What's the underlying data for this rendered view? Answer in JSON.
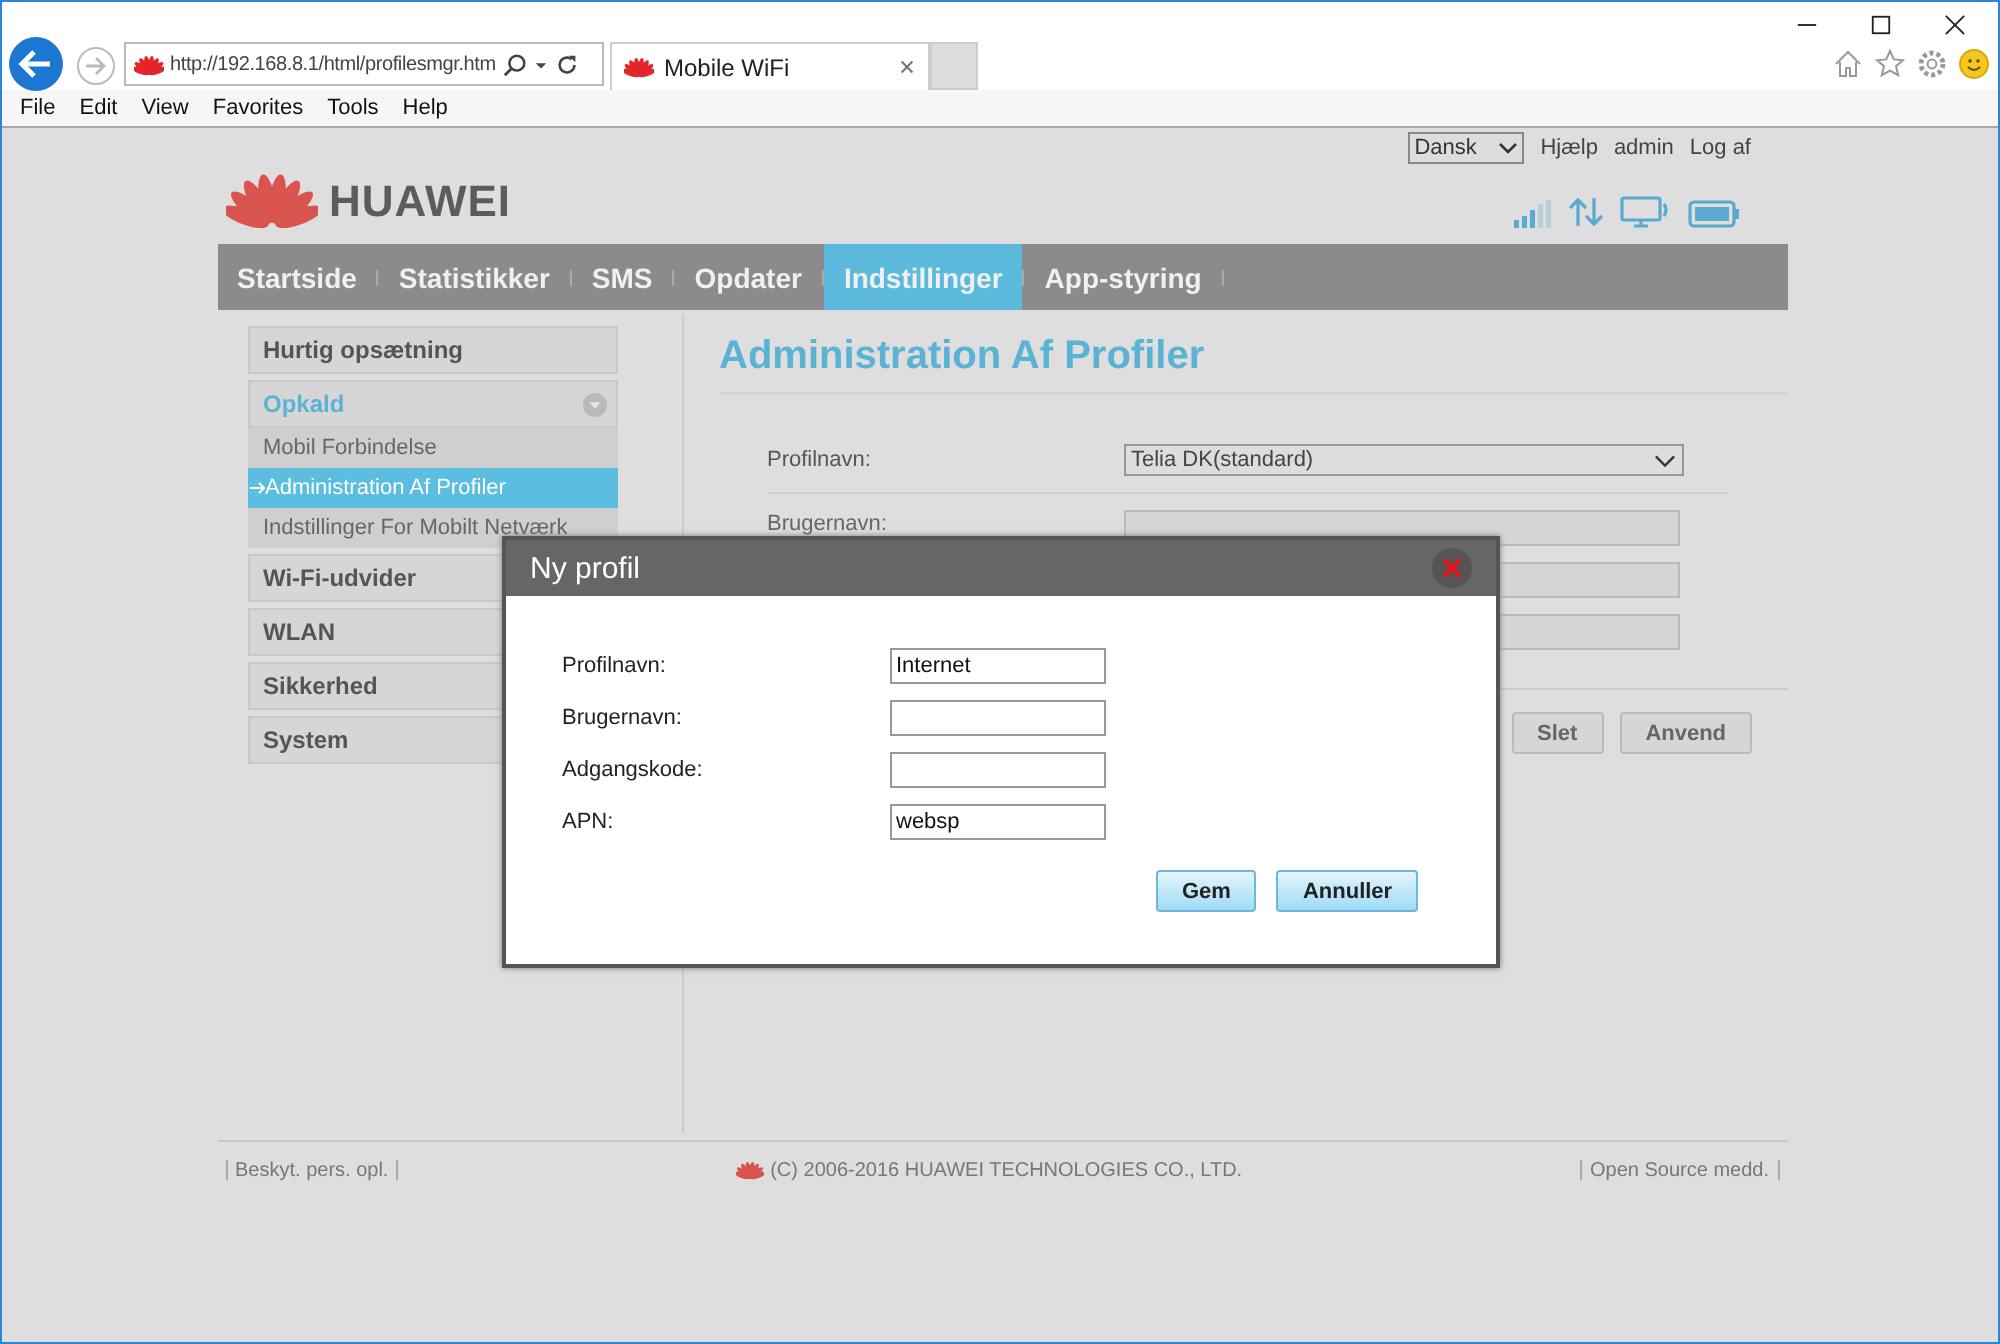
{
  "browser": {
    "url": "http://192.168.8.1/html/profilesmgr.htm",
    "tab_title": "Mobile WiFi",
    "menu": [
      "File",
      "Edit",
      "View",
      "Favorites",
      "Tools",
      "Help"
    ]
  },
  "header": {
    "language": "Dansk",
    "links": [
      "Hjælp",
      "admin",
      "Log af"
    ],
    "brand": "HUAWEI"
  },
  "nav": [
    {
      "label": "Startside",
      "selected": false
    },
    {
      "label": "Statistikker",
      "selected": false
    },
    {
      "label": "SMS",
      "selected": false
    },
    {
      "label": "Opdater",
      "selected": false
    },
    {
      "label": "Indstillinger",
      "selected": true
    },
    {
      "label": "App-styring",
      "selected": false
    }
  ],
  "sidebar": {
    "items": [
      {
        "label": "Hurtig opsætning",
        "expanded": false
      },
      {
        "label": "Opkald",
        "expanded": true,
        "children": [
          {
            "label": "Mobil Forbindelse",
            "selected": false
          },
          {
            "label": "Administration Af Profiler",
            "selected": true
          },
          {
            "label": "Indstillinger For Mobilt Netværk",
            "selected": false
          }
        ]
      },
      {
        "label": "Wi-Fi-udvider",
        "expanded": false
      },
      {
        "label": "WLAN",
        "expanded": false
      },
      {
        "label": "Sikkerhed",
        "expanded": false
      },
      {
        "label": "System",
        "expanded": false
      }
    ]
  },
  "main": {
    "title": "Administration Af Profiler",
    "profile_label": "Profilnavn:",
    "profile_value": "Telia DK(standard)",
    "fields": [
      {
        "label": "Brugernavn:",
        "disabled": true
      },
      {
        "disabled": true
      },
      {
        "disabled": true
      }
    ],
    "buttons": [
      "Slet",
      "Anvend"
    ]
  },
  "dialog": {
    "title": "Ny profil",
    "fields": [
      {
        "label": "Profilnavn:",
        "value": "Internet"
      },
      {
        "label": "Brugernavn:"
      },
      {
        "label": "Adgangskode:"
      },
      {
        "label": "APN:",
        "value": "websp"
      }
    ],
    "buttons": [
      "Gem",
      "Annuller"
    ]
  },
  "footer": {
    "left": "Beskyt. pers. opl.",
    "center": "(C) 2006-2016 HUAWEI TECHNOLOGIES CO., LTD.",
    "right": "Open Source medd."
  }
}
